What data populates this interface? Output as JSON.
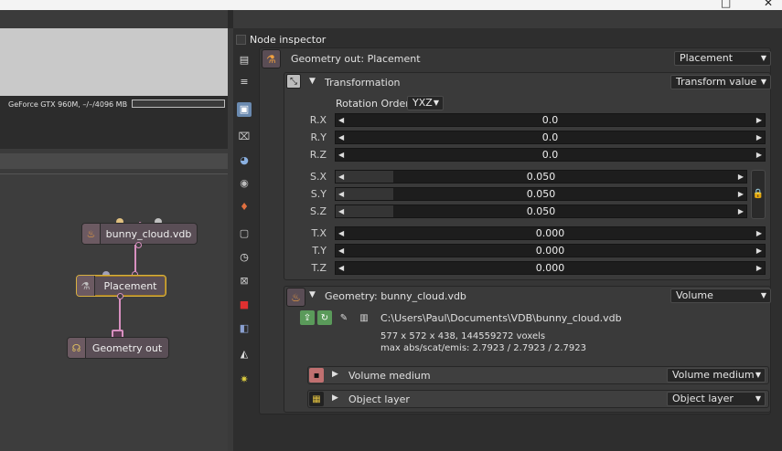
{
  "window": {
    "minimize_glyph": "□",
    "close_glyph": "✕"
  },
  "render_info": {
    "gpu": "GeForce GTX 960M, –/–/4096 MB"
  },
  "graph": {
    "nodes": [
      {
        "label": "bunny_cloud.vdb",
        "icon": "flame-icon"
      },
      {
        "label": "Placement",
        "icon": "placement-icon"
      },
      {
        "label": "Geometry out",
        "icon": "geometry-out-icon"
      }
    ]
  },
  "inspector": {
    "title": "Node inspector",
    "geometry_out_label": "Geometry out: Placement",
    "geometry_out_dropdown": "Placement",
    "transformation": {
      "label": "Transformation",
      "dropdown": "Transform value",
      "rotation_order_label": "Rotation Order",
      "rotation_order_value": "YXZ",
      "rows": [
        {
          "label": "R.X",
          "value": "0.0",
          "fill": 0
        },
        {
          "label": "R.Y",
          "value": "0.0",
          "fill": 0
        },
        {
          "label": "R.Z",
          "value": "0.0",
          "fill": 0
        },
        {
          "label": "S.X",
          "value": "0.050",
          "fill": 0.14
        },
        {
          "label": "S.Y",
          "value": "0.050",
          "fill": 0.14
        },
        {
          "label": "S.Z",
          "value": "0.050",
          "fill": 0.14
        },
        {
          "label": "T.X",
          "value": "0.000",
          "fill": 0
        },
        {
          "label": "T.Y",
          "value": "0.000",
          "fill": 0
        },
        {
          "label": "T.Z",
          "value": "0.000",
          "fill": 0
        }
      ]
    },
    "geometry": {
      "label": "Geometry: bunny_cloud.vdb",
      "dropdown": "Volume",
      "path": "C:\\Users\\Paul\\Documents\\VDB\\bunny_cloud.vdb",
      "voxels": "577 x 572 x 438, 144559272 voxels",
      "stats": "max abs/scat/emis: 2.7923 / 2.7923 / 2.7923",
      "volume_medium_label": "Volume medium",
      "volume_medium_dropdown": "Volume medium",
      "object_layer_label": "Object layer",
      "object_layer_dropdown": "Object layer"
    }
  },
  "colors": {
    "accent": "#d8b040",
    "wire": "#d890c0",
    "panel": "#363636"
  }
}
